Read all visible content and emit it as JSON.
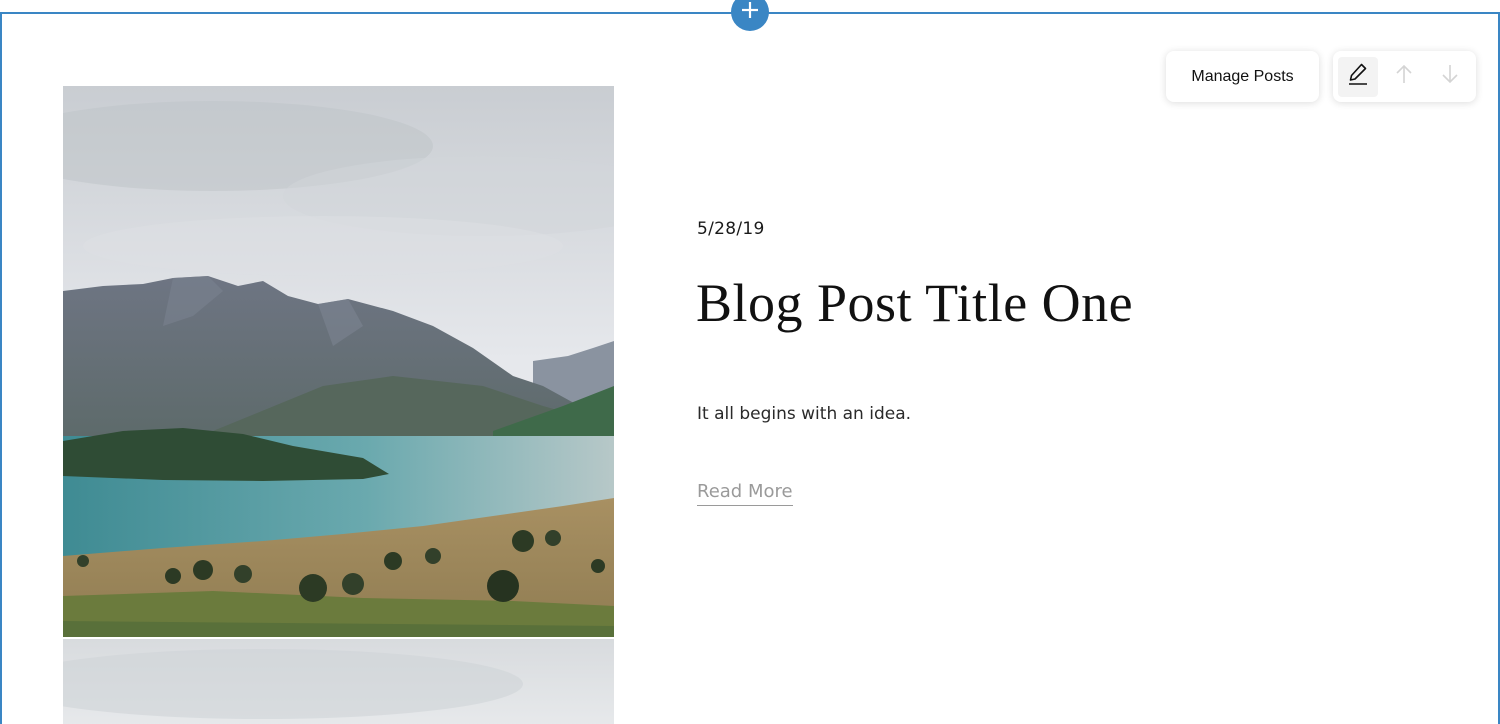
{
  "toolbar": {
    "manage_posts_label": "Manage Posts",
    "edit_icon": "pencil-icon",
    "move_up_icon": "arrow-up-icon",
    "move_down_icon": "arrow-down-icon"
  },
  "section": {
    "add_icon": "plus-icon",
    "accent_color": "#3a86c4"
  },
  "post": {
    "date": "5/28/19",
    "title": "Blog Post Title One",
    "excerpt": "It all begins with an idea.",
    "read_more_label": "Read More"
  }
}
